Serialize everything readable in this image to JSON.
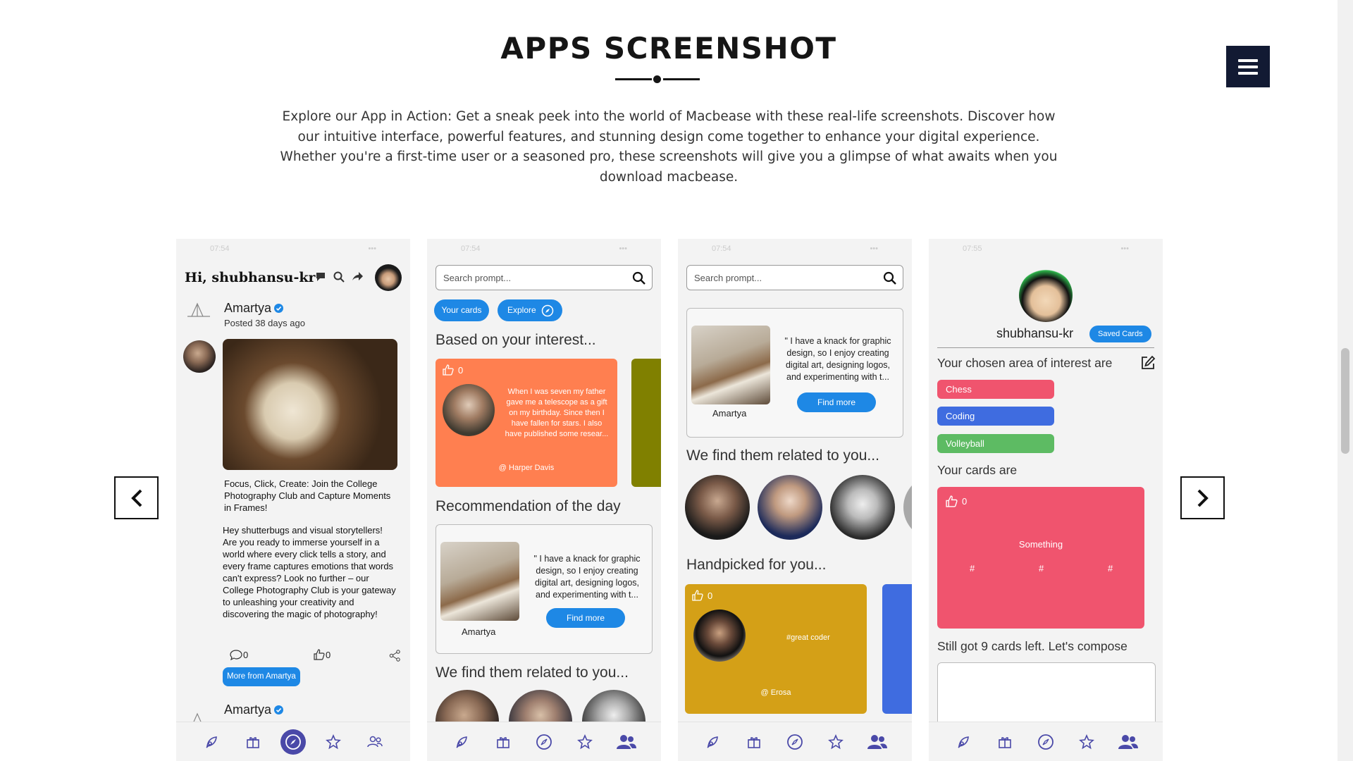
{
  "section": {
    "title": "APPS SCREENSHOT",
    "intro": "Explore our App in Action: Get a sneak peek into the world of Macbease with these real-life screenshots. Discover how our intuitive interface, powerful features, and stunning design come together to enhance your digital experience. Whether you're a first-time user or a seasoned pro, these screenshots will give you a glimpse of what awaits when you download macbease."
  },
  "colors": {
    "menu_bg": "#121a33",
    "primary_blue": "#1e88e5",
    "nav_active": "#4a49a8",
    "orange_card": "#ff7f50",
    "gold_card": "#d4a017",
    "pink_card": "#f0546e"
  },
  "phone1": {
    "greeting": "Hi, shubhansu-kr",
    "author": "Amartya",
    "posted": "Posted 38 days ago",
    "title": "Focus, Click, Create: Join the College Photography Club and Capture Moments in Frames!",
    "body": "Hey shutterbugs and visual storytellers! Are you ready to immerse yourself in a world where every click tells a story, and every frame captures emotions that words can't express? Look no further – our College Photography Club is your gateway to unleashing your creativity and discovering the magic of photography!",
    "comments": "0",
    "likes": "0",
    "more_button": "More from Amartya",
    "next_author": "Amartya"
  },
  "phone2": {
    "search_placeholder": "Search prompt...",
    "chip_cards": "Your cards",
    "chip_explore": "Explore",
    "heading_interest": "Based on your interest...",
    "card_likes": "0",
    "card_text": "When I was seven my father gave me a telescope as a gift on my birthday. Since then I have fallen for stars. I also have published some resear...",
    "card_author": "@ Harper Davis",
    "heading_rec": "Recommendation of the day",
    "rec_quote": "\" I have a knack for graphic design, so I enjoy creating digital art, designing logos, and experimenting with t...",
    "rec_button": "Find more",
    "rec_name": "Amartya",
    "heading_related": "We find them related to you..."
  },
  "phone3": {
    "search_placeholder": "Search prompt...",
    "rec_quote": "\" I have a knack for graphic design, so I enjoy creating digital art, designing logos, and experimenting with t...",
    "rec_button": "Find more",
    "rec_name": "Amartya",
    "heading_related": "We find them related to you...",
    "heading_handpicked": "Handpicked for you...",
    "card_likes": "0",
    "card_tag": "#great coder",
    "card_author": "@ Erosa"
  },
  "phone4": {
    "username": "shubhansu-kr",
    "saved_button": "Saved Cards",
    "interest_heading": "Your chosen area of interest are",
    "interests": [
      "Chess",
      "Coding",
      "Volleyball"
    ],
    "cards_heading": "Your cards are",
    "card_likes": "0",
    "card_title": "Something",
    "card_tags": [
      "#",
      "#",
      "#"
    ],
    "compose_text": "Still got 9 cards left. Let's compose"
  },
  "nav_icons": [
    "rocket-icon",
    "gift-icon",
    "compass-icon",
    "star-icon",
    "people-icon"
  ]
}
